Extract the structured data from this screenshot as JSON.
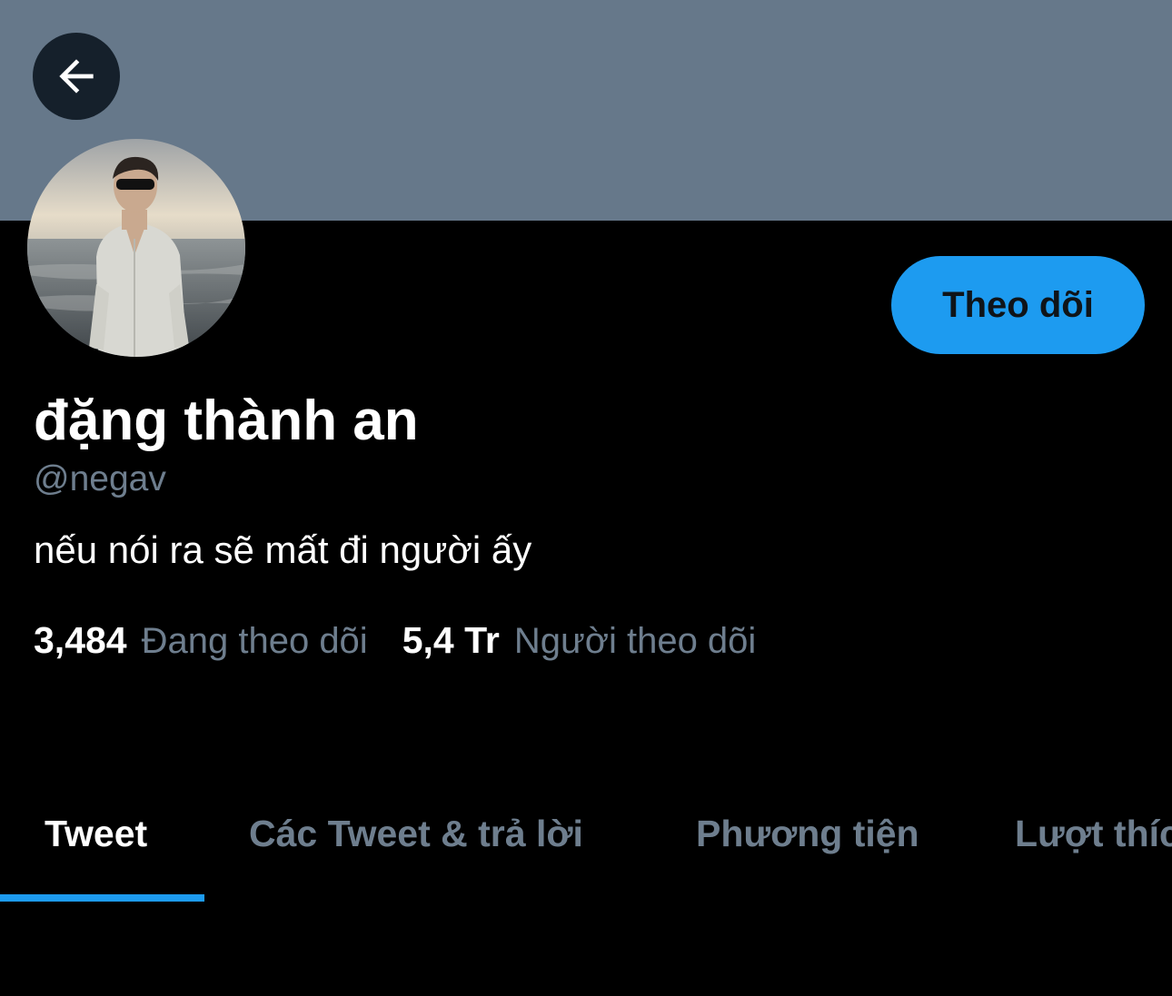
{
  "header": {
    "back_icon": "arrow-left-icon",
    "banner_color": "#66788a"
  },
  "profile": {
    "display_name": "đặng thành an",
    "handle": "@negav",
    "bio": "nếu nói ra sẽ mất đi người ấy",
    "follow_button_label": "Theo dõi",
    "avatar_icon": "profile-photo"
  },
  "stats": {
    "following_count": "3,484",
    "following_label": "Đang theo dõi",
    "followers_count": "5,4 Tr",
    "followers_label": "Người theo dõi"
  },
  "tabs": [
    {
      "label": "Tweet",
      "active": true
    },
    {
      "label": "Các Tweet & trả lời",
      "active": false
    },
    {
      "label": "Phương tiện",
      "active": false
    },
    {
      "label": "Lượt thích",
      "active": false
    }
  ],
  "colors": {
    "accent": "#1d9bf0",
    "background": "#000000",
    "secondary_text": "#6e7e8e"
  }
}
